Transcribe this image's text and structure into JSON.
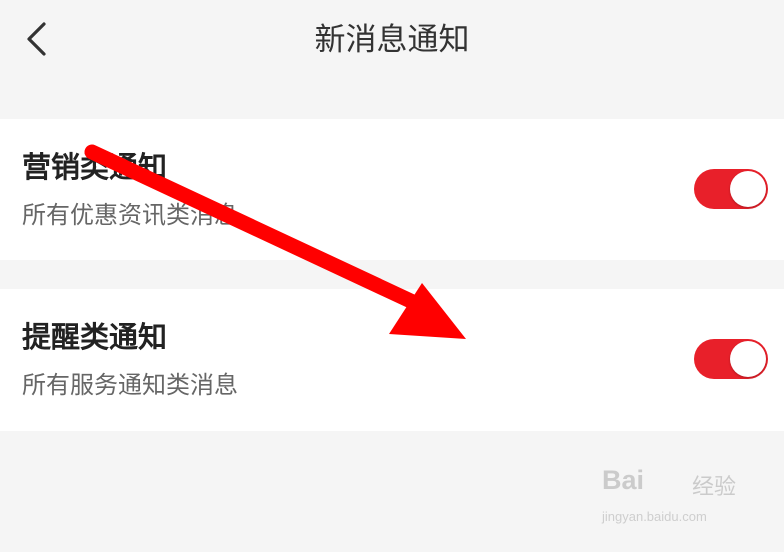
{
  "header": {
    "title": "新消息通知",
    "back_icon": "chevron-left-icon"
  },
  "settings": [
    {
      "title": "营销类通知",
      "description": "所有优惠资讯类消息",
      "enabled": true
    },
    {
      "title": "提醒类通知",
      "description": "所有服务通知类消息",
      "enabled": true
    }
  ],
  "colors": {
    "toggle_on": "#e8202a",
    "annotation_arrow": "#ff0000"
  },
  "watermark": {
    "brand": "Bai",
    "brand_suffix": "经验",
    "url": "jingyan.baidu.com"
  }
}
